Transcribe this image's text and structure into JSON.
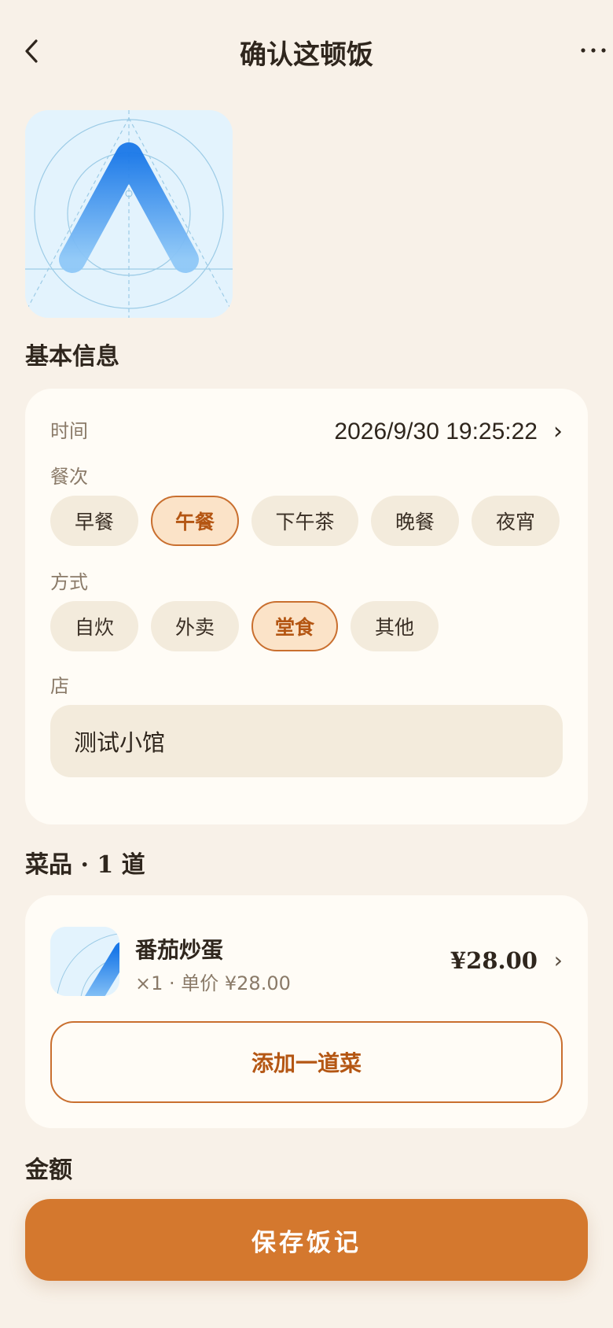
{
  "header": {
    "title": "确认这顿饭",
    "back_icon": "chevron-left-icon",
    "more_icon": "more-horizontal-icon"
  },
  "photo": {
    "icon": "app-logo-placeholder"
  },
  "basic_info": {
    "section_title": "基本信息",
    "time_label": "时间",
    "time_value": "2026/9/30 19:25:22",
    "time_chevron": "›",
    "meal_label": "餐次",
    "meals": [
      "早餐",
      "午餐",
      "下午茶",
      "晚餐",
      "夜宵"
    ],
    "meal_selected": "午餐",
    "mode_label": "方式",
    "modes": [
      "自炊",
      "外卖",
      "堂食",
      "其他"
    ],
    "mode_selected": "堂食",
    "store_label": "店",
    "store_value": "测试小馆"
  },
  "dishes": {
    "section_title": "菜品 · 1 道",
    "items": [
      {
        "name": "番茄炒蛋",
        "sub": "×1 · 单价 ¥28.00",
        "price": "¥28.00",
        "chevron": "›"
      }
    ],
    "add_label": "添加一道菜"
  },
  "amount": {
    "section_title": "金额"
  },
  "footer": {
    "save_label": "保存饭记"
  },
  "colors": {
    "background": "#f8f1e8",
    "card": "#fffcf6",
    "accent": "#d4782e",
    "accent_text": "#b45613",
    "chip": "#f3ebdc",
    "chip_active": "#fbe3c8"
  }
}
